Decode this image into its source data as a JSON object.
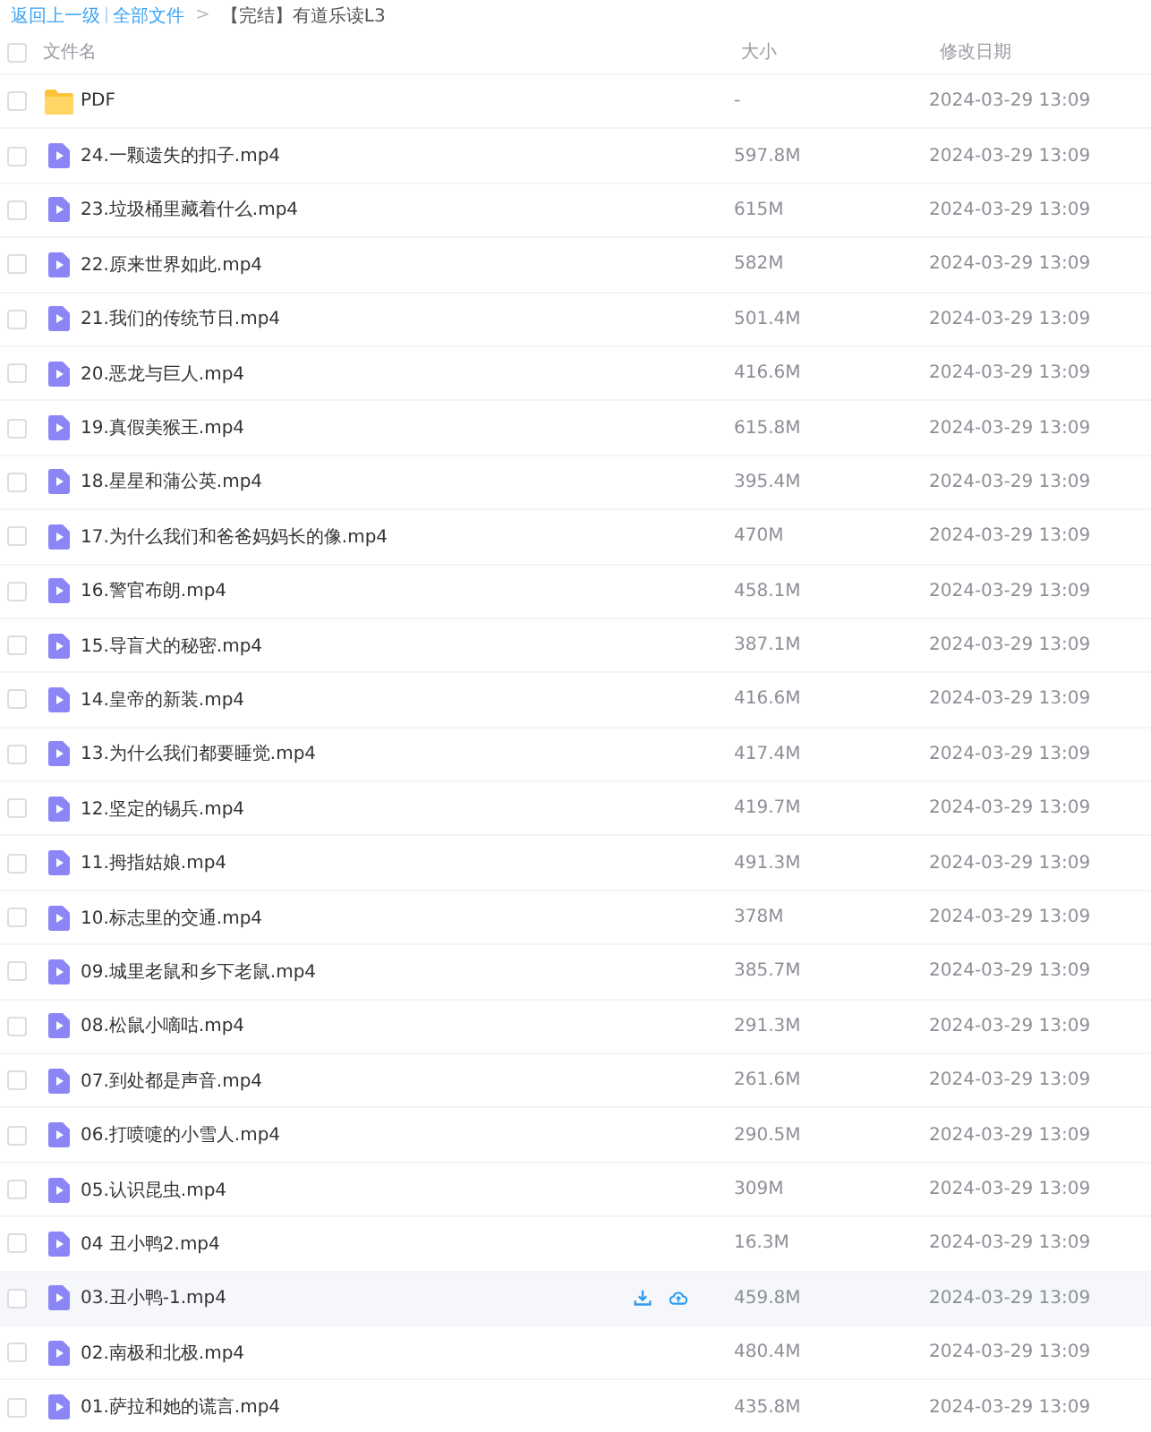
{
  "breadcrumb": {
    "back": "返回上一级",
    "root": "全部文件",
    "separator": ">",
    "current": "【完结】有道乐读L3"
  },
  "table": {
    "select_all_checked": false,
    "columns": [
      "文件名",
      "大小",
      "修改日期"
    ],
    "rows": [
      {
        "kind": "folder",
        "name": "PDF",
        "size": "-",
        "date": "2024-03-29 13:09",
        "checked": false,
        "hovered": false
      },
      {
        "kind": "video",
        "name": "24.一颗遗失的扣子.mp4",
        "size": "597.8M",
        "date": "2024-03-29 13:09",
        "checked": false,
        "hovered": false
      },
      {
        "kind": "video",
        "name": "23.垃圾桶里藏着什么.mp4",
        "size": "615M",
        "date": "2024-03-29 13:09",
        "checked": false,
        "hovered": false
      },
      {
        "kind": "video",
        "name": "22.原来世界如此.mp4",
        "size": "582M",
        "date": "2024-03-29 13:09",
        "checked": false,
        "hovered": false
      },
      {
        "kind": "video",
        "name": "21.我们的传统节日.mp4",
        "size": "501.4M",
        "date": "2024-03-29 13:09",
        "checked": false,
        "hovered": false
      },
      {
        "kind": "video",
        "name": "20.恶龙与巨人.mp4",
        "size": "416.6M",
        "date": "2024-03-29 13:09",
        "checked": false,
        "hovered": false
      },
      {
        "kind": "video",
        "name": "19.真假美猴王.mp4",
        "size": "615.8M",
        "date": "2024-03-29 13:09",
        "checked": false,
        "hovered": false
      },
      {
        "kind": "video",
        "name": "18.星星和蒲公英.mp4",
        "size": "395.4M",
        "date": "2024-03-29 13:09",
        "checked": false,
        "hovered": false
      },
      {
        "kind": "video",
        "name": "17.为什么我们和爸爸妈妈长的像.mp4",
        "size": "470M",
        "date": "2024-03-29 13:09",
        "checked": false,
        "hovered": false
      },
      {
        "kind": "video",
        "name": "16.警官布朗.mp4",
        "size": "458.1M",
        "date": "2024-03-29 13:09",
        "checked": false,
        "hovered": false
      },
      {
        "kind": "video",
        "name": "15.导盲犬的秘密.mp4",
        "size": "387.1M",
        "date": "2024-03-29 13:09",
        "checked": false,
        "hovered": false
      },
      {
        "kind": "video",
        "name": "14.皇帝的新装.mp4",
        "size": "416.6M",
        "date": "2024-03-29 13:09",
        "checked": false,
        "hovered": false
      },
      {
        "kind": "video",
        "name": "13.为什么我们都要睡觉.mp4",
        "size": "417.4M",
        "date": "2024-03-29 13:09",
        "checked": false,
        "hovered": false
      },
      {
        "kind": "video",
        "name": "12.坚定的锡兵.mp4",
        "size": "419.7M",
        "date": "2024-03-29 13:09",
        "checked": false,
        "hovered": false
      },
      {
        "kind": "video",
        "name": "11.拇指姑娘.mp4",
        "size": "491.3M",
        "date": "2024-03-29 13:09",
        "checked": false,
        "hovered": false
      },
      {
        "kind": "video",
        "name": "10.标志里的交通.mp4",
        "size": "378M",
        "date": "2024-03-29 13:09",
        "checked": false,
        "hovered": false
      },
      {
        "kind": "video",
        "name": "09.城里老鼠和乡下老鼠.mp4",
        "size": "385.7M",
        "date": "2024-03-29 13:09",
        "checked": false,
        "hovered": false
      },
      {
        "kind": "video",
        "name": "08.松鼠小嘀咕.mp4",
        "size": "291.3M",
        "date": "2024-03-29 13:09",
        "checked": false,
        "hovered": false
      },
      {
        "kind": "video",
        "name": "07.到处都是声音.mp4",
        "size": "261.6M",
        "date": "2024-03-29 13:09",
        "checked": false,
        "hovered": false
      },
      {
        "kind": "video",
        "name": "06.打喷嚏的小雪人.mp4",
        "size": "290.5M",
        "date": "2024-03-29 13:09",
        "checked": false,
        "hovered": false
      },
      {
        "kind": "video",
        "name": "05.认识昆虫.mp4",
        "size": "309M",
        "date": "2024-03-29 13:09",
        "checked": false,
        "hovered": false
      },
      {
        "kind": "video",
        "name": "04 丑小鸭2.mp4",
        "size": "16.3M",
        "date": "2024-03-29 13:09",
        "checked": false,
        "hovered": false
      },
      {
        "kind": "video",
        "name": "03.丑小鸭-1.mp4",
        "size": "459.8M",
        "date": "2024-03-29 13:09",
        "checked": false,
        "hovered": true
      },
      {
        "kind": "video",
        "name": "02.南极和北极.mp4",
        "size": "480.4M",
        "date": "2024-03-29 13:09",
        "checked": false,
        "hovered": false
      },
      {
        "kind": "video",
        "name": "01.萨拉和她的谎言.mp4",
        "size": "435.8M",
        "date": "2024-03-29 13:09",
        "checked": false,
        "hovered": false
      }
    ]
  }
}
